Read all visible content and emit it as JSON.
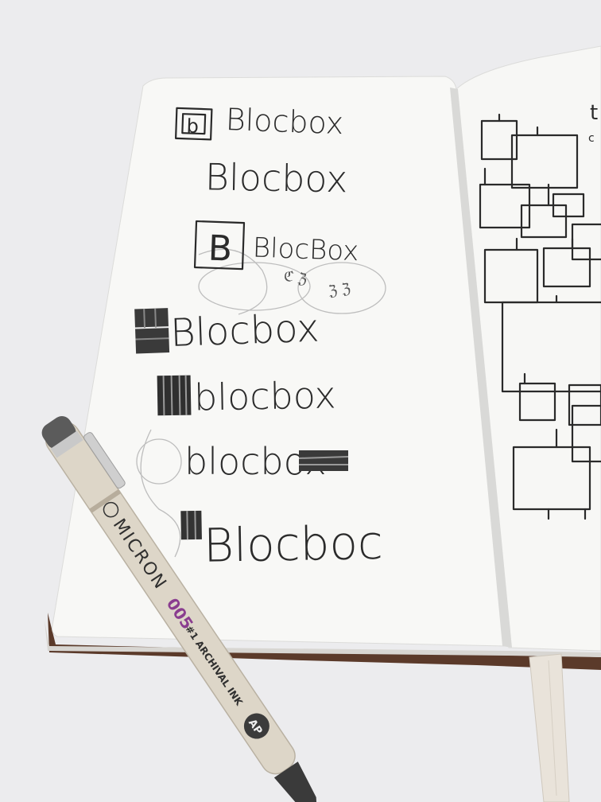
{
  "left_page": {
    "sketches": [
      "Blocbox",
      "Blocbox",
      "BlocBox",
      "Blocbox",
      "blocbox",
      "blocbox",
      "Blocboc"
    ],
    "icon_letters": {
      "first": "b",
      "third": "B"
    }
  },
  "pen": {
    "brand": "MICRON",
    "size": "005",
    "tagline": "#1 ARCHIVAL INK",
    "badge": "AP"
  },
  "colors": {
    "surface": "#ebebed",
    "paper": "#f7f7f5",
    "ink": "#2a2a2a",
    "pen_body": "#ddd6c8",
    "pen_size_text": "#8a3d8f",
    "ribbon": "#e8e2da",
    "cover": "#5a3a2b"
  }
}
